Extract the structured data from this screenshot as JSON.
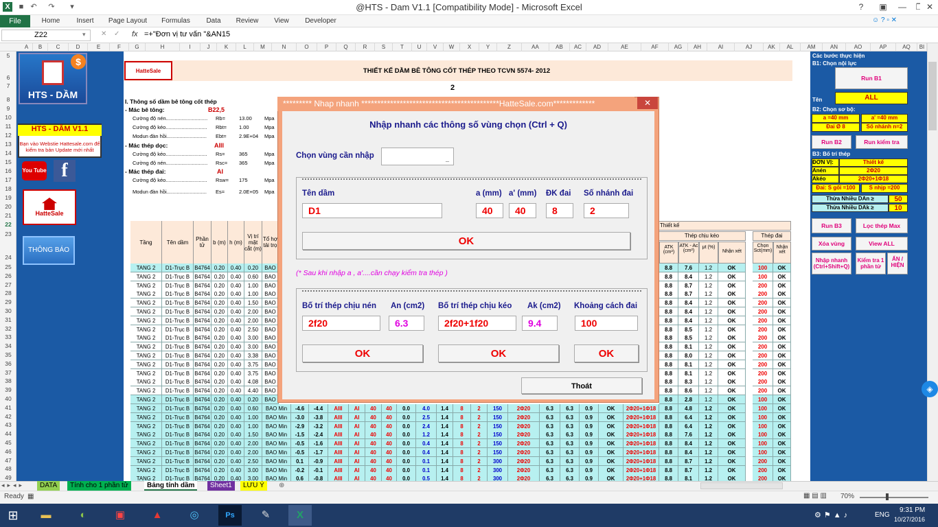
{
  "window": {
    "title": "@HTS - Dam V1.1  [Compatibility Mode]  -  Microsoft Excel"
  },
  "ribbon": {
    "file": "File",
    "tabs": [
      "Home",
      "Insert",
      "Page Layout",
      "Formulas",
      "Data",
      "Review",
      "View",
      "Developer"
    ]
  },
  "formula": {
    "namebox": "Z22",
    "fx": "fx",
    "content": "=+\"Đơn vị tư vấn \"&AN15"
  },
  "columns": [
    "A",
    "B",
    "C",
    "D",
    "E",
    "F",
    "G",
    "H",
    "I",
    "J",
    "K",
    "L",
    "M",
    "N",
    "O",
    "P",
    "Q",
    "R",
    "S",
    "T",
    "U",
    "V",
    "W",
    "X",
    "Y",
    "Z",
    "AA",
    "AB",
    "AC",
    "AD",
    "AE",
    "AF",
    "AG",
    "AH",
    "AI",
    "AJ",
    "AK",
    "AL",
    "AM",
    "AN",
    "AO",
    "AP",
    "AQ",
    "BI"
  ],
  "rows": [
    "5",
    "6",
    "7",
    "8",
    "9",
    "10",
    "11",
    "12",
    "13",
    "14",
    "15",
    "16",
    "17",
    "18",
    "19",
    "20",
    "21",
    "22",
    "23",
    "24",
    "25",
    "26",
    "27",
    "28",
    "29",
    "30",
    "31",
    "32",
    "33",
    "34",
    "35",
    "36",
    "37",
    "38",
    "39",
    "40",
    "41",
    "42",
    "43",
    "44",
    "45",
    "46",
    "47",
    "48",
    "49"
  ],
  "left_panel": {
    "logo": "HTS - DẦM",
    "promo_title": "HTS - DẦM V1.1",
    "promo_text": "Bạn vào Webstie Hattesale.com để kiểm tra bản Update mới nhất",
    "youtube": "You Tube",
    "brand": "HatteSale",
    "notify_button": "THÔNG BÁO"
  },
  "sheet": {
    "brand": "HatteSale",
    "title": "THIẾT KẾ DẦM BÊ TÔNG CỐT THÉP THEO TCVN 5574- 2012",
    "marker": "2",
    "sec1": "I. Thông số dầm bê tông cốt thép",
    "mac_bt_label": "- Mác bê tông:",
    "mac_bt_val": "B22,5",
    "mac_thep_doc_label": "- Mác thép dọc:",
    "mac_thep_doc_val": "AIII",
    "mac_thep_dai_label": "- Mác thép đai:",
    "mac_thep_dai_val": "AI",
    "params": [
      {
        "name": "Cường độ nén.............................",
        "sym": "Rb=",
        "val": "13.00",
        "unit": "Mpa"
      },
      {
        "name": "Cường độ kéo.............................",
        "sym": "Rbt=",
        "val": "1.00",
        "unit": "Mpa"
      },
      {
        "name": "Modun đàn hồi............................",
        "sym": "Ebt=",
        "val": "2.9E+04",
        "unit": "Mpa"
      },
      {
        "name": "Cường độ kéo.............................",
        "sym": "Rs=",
        "val": "365",
        "unit": "Mpa"
      },
      {
        "name": "Cường độ nén.............................",
        "sym": "Rsc=",
        "val": "365",
        "unit": "Mpa"
      },
      {
        "name": "Cường độ kéo.............................",
        "sym": "Rsw=",
        "val": "175",
        "unit": "Mpa"
      },
      {
        "name": "Modun đàn hồi............................",
        "sym": "Es=",
        "val": "2.0E+05",
        "unit": "Mpa"
      }
    ],
    "table_headers": [
      "Tầng",
      "Tên dầm",
      "Phần tử",
      "b (m)",
      "h (m)",
      "Vị trí mặt cắt (m)",
      "Tổ hợ tải trọ"
    ],
    "right_headers": {
      "thiet_ke": "Thiết kế",
      "thep_chiu_keo": "Thép chịu kéo",
      "thep_dai": "Thép đai",
      "a_tk": "ATK (cm²)",
      "a_tk_diff": "ATK - Ac (cm²)",
      "mu": "μt (%)",
      "nhan_xet": "Nhận xét",
      "chon": "Chọn Sct(mm)",
      "nhan_xet2": "Nhận xét"
    },
    "rows": [
      {
        "n": "25",
        "t": "TANG 2",
        "d": "D1-Trục B",
        "p": "B4764",
        "b": "0.20",
        "h": "0.40",
        "v": "0.20",
        "th": "BAO",
        "a": "8.8",
        "ad": "7.6",
        "mu": "1.2",
        "nx": "OK",
        "nx1": "OK",
        "s": "100",
        "nx2": "OK",
        "c": "cyan"
      },
      {
        "n": "26",
        "t": "TANG 2",
        "d": "D1-Trục B",
        "p": "B4764",
        "b": "0.20",
        "h": "0.40",
        "v": "0.60",
        "th": "BAO",
        "a": "8.8",
        "ad": "8.4",
        "mu": "1.2",
        "nx": "OK",
        "nx1": "OK",
        "s": "100",
        "nx2": "OK",
        "c": "white"
      },
      {
        "n": "27",
        "t": "TANG 2",
        "d": "D1-Trục B",
        "p": "B4764",
        "b": "0.20",
        "h": "0.40",
        "v": "1.00",
        "th": "BAO",
        "a": "8.8",
        "ad": "8.7",
        "mu": "1.2",
        "nx": "OK",
        "nx1": "OK",
        "s": "200",
        "nx2": "OK",
        "c": "white"
      },
      {
        "n": "28",
        "t": "TANG 2",
        "d": "D1-Trục B",
        "p": "B4764",
        "b": "0.20",
        "h": "0.40",
        "v": "1.00",
        "th": "BAO",
        "a": "8.8",
        "ad": "8.7",
        "mu": "1.2",
        "nx": "OK",
        "nx1": "OK",
        "s": "200",
        "nx2": "OK",
        "c": "white"
      },
      {
        "n": "29",
        "t": "TANG 2",
        "d": "D1-Trục B",
        "p": "B4764",
        "b": "0.20",
        "h": "0.40",
        "v": "1.50",
        "th": "BAO",
        "a": "8.8",
        "ad": "8.4",
        "mu": "1.2",
        "nx": "OK",
        "nx1": "OK",
        "s": "200",
        "nx2": "OK",
        "c": "white"
      },
      {
        "n": "30",
        "t": "TANG 2",
        "d": "D1-Trục B",
        "p": "B4764",
        "b": "0.20",
        "h": "0.40",
        "v": "2.00",
        "th": "BAO",
        "a": "8.8",
        "ad": "8.4",
        "mu": "1.2",
        "nx": "OK",
        "nx1": "OK",
        "s": "200",
        "nx2": "OK",
        "c": "white"
      },
      {
        "n": "31",
        "t": "TANG 2",
        "d": "D1-Trục B",
        "p": "B4764",
        "b": "0.20",
        "h": "0.40",
        "v": "2.00",
        "th": "BAO",
        "a": "8.8",
        "ad": "8.4",
        "mu": "1.2",
        "nx": "OK",
        "nx1": "OK",
        "s": "200",
        "nx2": "OK",
        "c": "white"
      },
      {
        "n": "32",
        "t": "TANG 2",
        "d": "D1-Trục B",
        "p": "B4764",
        "b": "0.20",
        "h": "0.40",
        "v": "2.50",
        "th": "BAO",
        "a": "8.8",
        "ad": "8.5",
        "mu": "1.2",
        "nx": "OK",
        "nx1": "OK",
        "s": "200",
        "nx2": "OK",
        "c": "white"
      },
      {
        "n": "33",
        "t": "TANG 2",
        "d": "D1-Trục B",
        "p": "B4764",
        "b": "0.20",
        "h": "0.40",
        "v": "3.00",
        "th": "BAO",
        "a": "8.8",
        "ad": "8.5",
        "mu": "1.2",
        "nx": "OK",
        "nx1": "OK",
        "s": "200",
        "nx2": "OK",
        "c": "white"
      },
      {
        "n": "34",
        "t": "TANG 2",
        "d": "D1-Trục B",
        "p": "B4764",
        "b": "0.20",
        "h": "0.40",
        "v": "3.00",
        "th": "BAO",
        "a": "8.8",
        "ad": "8.1",
        "mu": "1.2",
        "nx": "OK",
        "nx1": "OK",
        "s": "200",
        "nx2": "OK",
        "c": "white"
      },
      {
        "n": "35",
        "t": "TANG 2",
        "d": "D1-Trục B",
        "p": "B4764",
        "b": "0.20",
        "h": "0.40",
        "v": "3.38",
        "th": "BAO",
        "a": "8.8",
        "ad": "8.0",
        "mu": "1.2",
        "nx": "OK",
        "nx1": "OK",
        "s": "200",
        "nx2": "OK",
        "c": "white"
      },
      {
        "n": "36",
        "t": "TANG 2",
        "d": "D1-Trục B",
        "p": "B4764",
        "b": "0.20",
        "h": "0.40",
        "v": "3.75",
        "th": "BAO",
        "a": "8.8",
        "ad": "8.1",
        "mu": "1.2",
        "nx": "OK",
        "nx1": "OK",
        "s": "200",
        "nx2": "OK",
        "c": "white"
      },
      {
        "n": "37",
        "t": "TANG 2",
        "d": "D1-Trục B",
        "p": "B4764",
        "b": "0.20",
        "h": "0.40",
        "v": "3.75",
        "th": "BAO",
        "a": "8.8",
        "ad": "8.1",
        "mu": "1.2",
        "nx": "OK",
        "nx1": "OK",
        "s": "200",
        "nx2": "OK",
        "c": "white"
      },
      {
        "n": "38",
        "t": "TANG 2",
        "d": "D1-Trục B",
        "p": "B4764",
        "b": "0.20",
        "h": "0.40",
        "v": "4.08",
        "th": "BAO",
        "a": "8.8",
        "ad": "8.3",
        "mu": "1.2",
        "nx": "OK",
        "nx1": "OK",
        "s": "200",
        "nx2": "OK",
        "c": "white"
      },
      {
        "n": "39",
        "t": "TANG 2",
        "d": "D1-Trục B",
        "p": "B4764",
        "b": "0.20",
        "h": "0.40",
        "v": "4.40",
        "th": "BAO",
        "a": "8.8",
        "ad": "8.6",
        "mu": "1.2",
        "nx": "OK",
        "nx1": "OK",
        "s": "200",
        "nx2": "OK",
        "c": "white"
      },
      {
        "n": "40",
        "t": "TANG 2",
        "d": "D1-Trục B",
        "p": "B4764",
        "b": "0.20",
        "h": "0.40",
        "v": "0.20",
        "th": "BAO",
        "a": "8.8",
        "ad": "2.8",
        "mu": "1.2",
        "nx": "OK",
        "nx1": "OK",
        "s": "100",
        "nx2": "OK",
        "c": "cyan"
      }
    ],
    "lower_rows": [
      {
        "t": "TANG 2",
        "d": "D1-Trục B",
        "p": "B4764",
        "b": "0.20",
        "h": "0.40",
        "v": "0.60",
        "th": "BAO Min",
        "m1": "-4.6",
        "m2": "-4.4",
        "st": "AIII",
        "sd": "AI",
        "a1": "40",
        "a2": "40",
        "z": "0.0",
        "x1": "4.0",
        "x2": "1.4",
        "x3": "8",
        "x4": "2",
        "x5": "150",
        "bt": "2Φ20",
        "aa": "6.3",
        "ab": "6.3",
        "ac": "0.9",
        "ok": "OK",
        "ae": "2Φ20+1Φ18",
        "a": "8.8",
        "ad": "4.8",
        "mu": "1.2",
        "nx": "OK",
        "nx1": "OK",
        "s": "100",
        "nx2": "OK"
      },
      {
        "t": "TANG 2",
        "d": "D1-Trục B",
        "p": "B4764",
        "b": "0.20",
        "h": "0.40",
        "v": "1.00",
        "th": "BAO Min",
        "m1": "-3.0",
        "m2": "-3.8",
        "st": "AIII",
        "sd": "AI",
        "a1": "40",
        "a2": "40",
        "z": "0.0",
        "x1": "2.5",
        "x2": "1.4",
        "x3": "8",
        "x4": "2",
        "x5": "150",
        "bt": "2Φ20",
        "aa": "6.3",
        "ab": "6.3",
        "ac": "0.9",
        "ok": "OK",
        "ae": "2Φ20+1Φ18",
        "a": "8.8",
        "ad": "6.4",
        "mu": "1.2",
        "nx": "OK",
        "nx1": "OK",
        "s": "100",
        "nx2": "OK"
      },
      {
        "t": "TANG 2",
        "d": "D1-Trục B",
        "p": "B4764",
        "b": "0.20",
        "h": "0.40",
        "v": "1.00",
        "th": "BAO Min",
        "m1": "-2.9",
        "m2": "-3.2",
        "st": "AIII",
        "sd": "AI",
        "a1": "40",
        "a2": "40",
        "z": "0.0",
        "x1": "2.4",
        "x2": "1.4",
        "x3": "8",
        "x4": "2",
        "x5": "150",
        "bt": "2Φ20",
        "aa": "6.3",
        "ab": "6.3",
        "ac": "0.9",
        "ok": "OK",
        "ae": "2Φ20+1Φ18",
        "a": "8.8",
        "ad": "6.4",
        "mu": "1.2",
        "nx": "OK",
        "nx1": "OK",
        "s": "100",
        "nx2": "OK"
      },
      {
        "t": "TANG 2",
        "d": "D1-Trục B",
        "p": "B4764",
        "b": "0.20",
        "h": "0.40",
        "v": "1.50",
        "th": "BAO Min",
        "m1": "-1.5",
        "m2": "-2.4",
        "st": "AIII",
        "sd": "AI",
        "a1": "40",
        "a2": "40",
        "z": "0.0",
        "x1": "1.2",
        "x2": "1.4",
        "x3": "8",
        "x4": "2",
        "x5": "150",
        "bt": "2Φ20",
        "aa": "6.3",
        "ab": "6.3",
        "ac": "0.9",
        "ok": "OK",
        "ae": "2Φ20+1Φ18",
        "a": "8.8",
        "ad": "7.6",
        "mu": "1.2",
        "nx": "OK",
        "nx1": "OK",
        "s": "100",
        "nx2": "OK"
      },
      {
        "t": "TANG 2",
        "d": "D1-Trục B",
        "p": "B4764",
        "b": "0.20",
        "h": "0.40",
        "v": "2.00",
        "th": "BAO Min",
        "m1": "-0.5",
        "m2": "-1.6",
        "st": "AIII",
        "sd": "AI",
        "a1": "40",
        "a2": "40",
        "z": "0.0",
        "x1": "0.4",
        "x2": "1.4",
        "x3": "8",
        "x4": "2",
        "x5": "150",
        "bt": "2Φ20",
        "aa": "6.3",
        "ab": "6.3",
        "ac": "0.9",
        "ok": "OK",
        "ae": "2Φ20+1Φ18",
        "a": "8.8",
        "ad": "8.4",
        "mu": "1.2",
        "nx": "OK",
        "nx1": "OK",
        "s": "100",
        "nx2": "OK"
      },
      {
        "t": "TANG 2",
        "d": "D1-Trục B",
        "p": "B4764",
        "b": "0.20",
        "h": "0.40",
        "v": "2.00",
        "th": "BAO Min",
        "m1": "-0.5",
        "m2": "-1.7",
        "st": "AIII",
        "sd": "AI",
        "a1": "40",
        "a2": "40",
        "z": "0.0",
        "x1": "0.4",
        "x2": "1.4",
        "x3": "8",
        "x4": "2",
        "x5": "150",
        "bt": "2Φ20",
        "aa": "6.3",
        "ab": "6.3",
        "ac": "0.9",
        "ok": "OK",
        "ae": "2Φ20+1Φ18",
        "a": "8.8",
        "ad": "8.4",
        "mu": "1.2",
        "nx": "OK",
        "nx1": "OK",
        "s": "100",
        "nx2": "OK"
      },
      {
        "t": "TANG 2",
        "d": "D1-Trục B",
        "p": "B4764",
        "b": "0.20",
        "h": "0.40",
        "v": "2.50",
        "th": "BAO Min",
        "m1": "0.1",
        "m2": "-0.9",
        "st": "AIII",
        "sd": "AI",
        "a1": "40",
        "a2": "40",
        "z": "0.0",
        "x1": "0.1",
        "x2": "1.4",
        "x3": "8",
        "x4": "2",
        "x5": "300",
        "bt": "2Φ20",
        "aa": "6.3",
        "ab": "6.3",
        "ac": "0.9",
        "ok": "OK",
        "ae": "2Φ20+1Φ18",
        "a": "8.8",
        "ad": "8.7",
        "mu": "1.2",
        "nx": "OK",
        "nx1": "OK",
        "s": "200",
        "nx2": "OK"
      },
      {
        "t": "TANG 2",
        "d": "D1-Trục B",
        "p": "B4764",
        "b": "0.20",
        "h": "0.40",
        "v": "3.00",
        "th": "BAO Min",
        "m1": "-0.2",
        "m2": "-0.1",
        "st": "AIII",
        "sd": "AI",
        "a1": "40",
        "a2": "40",
        "z": "0.0",
        "x1": "0.1",
        "x2": "1.4",
        "x3": "8",
        "x4": "2",
        "x5": "300",
        "bt": "2Φ20",
        "aa": "6.3",
        "ab": "6.3",
        "ac": "0.9",
        "ok": "OK",
        "ae": "2Φ20+1Φ18",
        "a": "8.8",
        "ad": "8.7",
        "mu": "1.2",
        "nx": "OK",
        "nx1": "OK",
        "s": "200",
        "nx2": "OK"
      },
      {
        "t": "TANG 2",
        "d": "D1-Trục B",
        "p": "B4764",
        "b": "0.20",
        "h": "0.40",
        "v": "3.00",
        "th": "BAO Min",
        "m1": "0.6",
        "m2": "-0.8",
        "st": "AIII",
        "sd": "AI",
        "a1": "40",
        "a2": "40",
        "z": "0.0",
        "x1": "0.5",
        "x2": "1.4",
        "x3": "8",
        "x4": "2",
        "x5": "300",
        "bt": "2Φ20",
        "aa": "6.3",
        "ab": "6.3",
        "ac": "0.9",
        "ok": "OK",
        "ae": "2Φ20+1Φ18",
        "a": "8.8",
        "ad": "8.1",
        "mu": "1.2",
        "nx": "OK",
        "nx1": "OK",
        "s": "200",
        "nx2": "OK"
      }
    ]
  },
  "right_panel": {
    "steps": "Các bước thực hiện",
    "b1": "B1: Chọn nội lực",
    "run_b1": "Run B1",
    "ten_label": "Tên",
    "ten_val": "ALL",
    "b2": "B2: Chọn sơ bộ:",
    "a": "a =40 mm",
    "a2": "a' =40 mm",
    "dai": "Đai Ø 8",
    "nhanh": "Số nhánh n=2",
    "run_b2": "Run B2",
    "run_kt": "Run kiểm tra",
    "b3": "B3: Bố trí thép",
    "donvi_l": "ĐƠN VỊ:",
    "donvi_v": "Thiết kế",
    "anen_l": "Anén",
    "anen_v": "2Φ20",
    "akeo_l": "Akéo",
    "akeo_v": "2Φ20+1Φ18",
    "dai_s": "Đai: S gối =100",
    "s_nhip": "S nhịp =200",
    "thua_an": "Thừa Nhiều  DAn ≥",
    "thua_an_v": "50",
    "thua_ak": "Thừa Nhiều  DAk ≥",
    "thua_ak_v": "10",
    "run_b3": "Run B3",
    "loc": "Lọc thép Max",
    "xoa": "Xóa vùng",
    "view_all": "View ALL",
    "nhap_nhanh": "Nhập nhanh (Ctrl+Shift+Q)",
    "kiem_tra": "Kiểm tra 1 phần tử",
    "an_hien": "ẨN / HIỆN"
  },
  "dialog": {
    "title": "********* Nhap nhanh *******************************************HatteSale.com*************",
    "close": "✕",
    "heading": "Nhập nhanh các thông số vùng chọn (Ctrl + Q)",
    "chon_vung": "Chọn vùng cần nhập",
    "ten_dam_label": "Tên dầm",
    "ten_dam_val": "D1",
    "a_label": "a (mm)",
    "a_val": "40",
    "a2_label": "a' (mm)",
    "a2_val": "40",
    "dk_label": "ĐK đai",
    "dk_val": "8",
    "so_nhanh_label": "Số nhánh đai",
    "so_nhanh_val": "2",
    "ok1": "OK",
    "note": "(* Sau khi nhập a , a'....cần chạy kiểm tra thép )",
    "bt_nen_label": "Bố trí thép chịu nén",
    "bt_nen_val": "2f20",
    "an_label": "An (cm2)",
    "an_val": "6.3",
    "bt_keo_label": "Bố trí thép chịu kéo",
    "bt_keo_val": "2f20+1f20",
    "ak_label": "Ak (cm2)",
    "ak_val": "9.4",
    "kc_label": "Khoảng cách đai",
    "kc_val": "100",
    "ok2": "OK",
    "ok3": "OK",
    "ok4": "OK",
    "exit": "Thoát"
  },
  "sheet_tabs": [
    "DATA",
    "Tính cho 1 phần tử",
    "Bảng tính dầm",
    "Sheet1",
    "LƯU Ý"
  ],
  "status": {
    "ready": "Ready",
    "zoom": "70%"
  },
  "taskbar": {
    "lang": "ENG",
    "time": "9:31 PM",
    "date": "10/27/2016"
  },
  "colors": {
    "excel_green": "#217346",
    "panel_blue": "#1b5aa5",
    "dialog_orange": "#f4a37c",
    "accent_red": "#e00000",
    "magenta": "#e000e0",
    "cyan_row": "#b7f0f0",
    "header_peach": "#fde9d9"
  }
}
